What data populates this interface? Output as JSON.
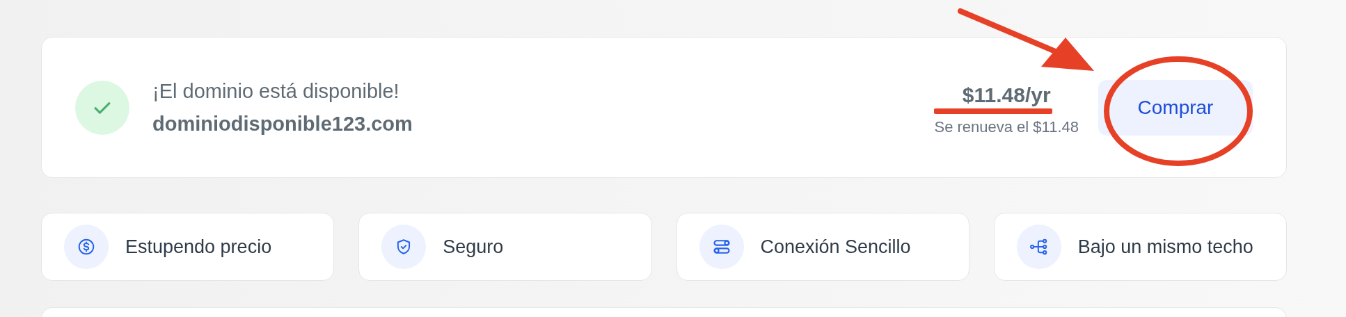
{
  "result": {
    "available": true,
    "message": "¡El dominio está disponible!",
    "domain": "dominiodisponible123.com",
    "price": "$11.48/yr",
    "renewal": "Se renueva el $11.48",
    "button": "Comprar"
  },
  "features": [
    {
      "kind": "dollar",
      "label": "Estupendo precio"
    },
    {
      "kind": "shield",
      "label": "Seguro"
    },
    {
      "kind": "toggles",
      "label": "Conexión Sencillo"
    },
    {
      "kind": "tree",
      "label": "Bajo un mismo techo"
    }
  ]
}
